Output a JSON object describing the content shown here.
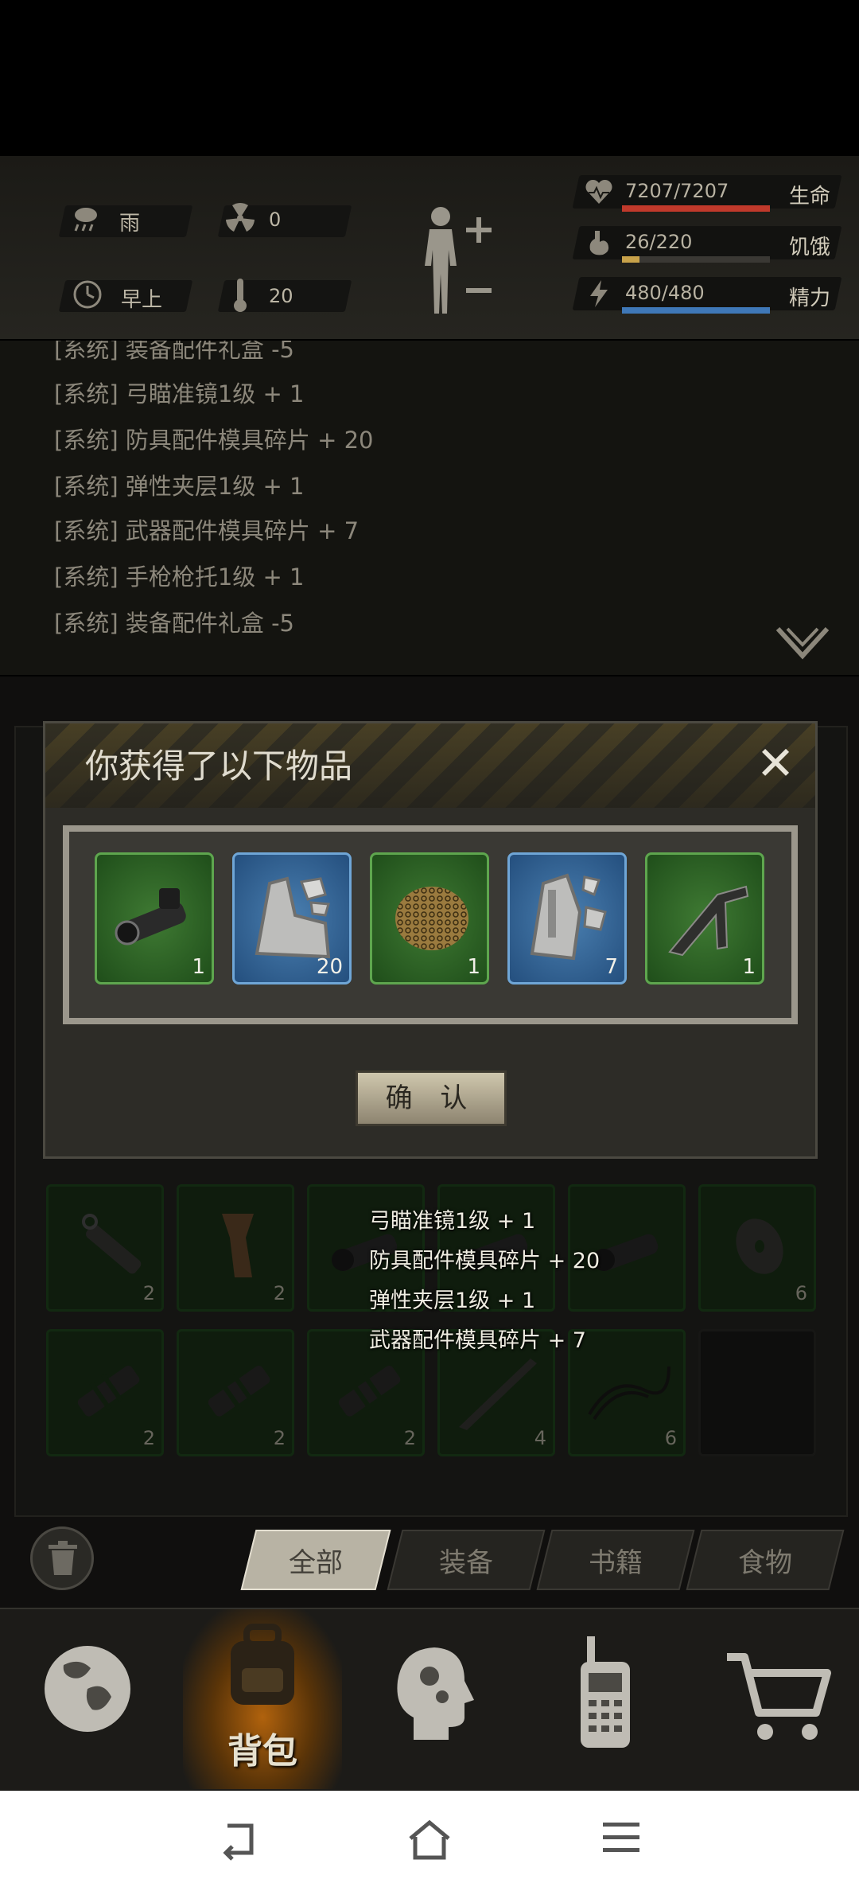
{
  "status": {
    "weather": "雨",
    "radiation": "0",
    "time_of_day": "早上",
    "temperature": "20",
    "health": {
      "text": "7207/7207",
      "label": "生命",
      "fraction": 1.0,
      "color": "#c0392b"
    },
    "hunger": {
      "text": "26/220",
      "label": "饥饿",
      "fraction": 0.118,
      "color": "#c8a24a"
    },
    "energy": {
      "text": "480/480",
      "label": "精力",
      "fraction": 1.0,
      "color": "#3f78b8"
    }
  },
  "log": [
    "[系统] 装备配件礼盒 -5",
    "[系统] 弓瞄准镜1级 + 1",
    "[系统] 防具配件模具碎片 + 20",
    "[系统] 弹性夹层1级 + 1",
    "[系统] 武器配件模具碎片 + 7",
    "[系统] 手枪枪托1级 + 1",
    "[系统] 装备配件礼盒 -5"
  ],
  "popup": {
    "title": "你获得了以下物品",
    "confirm_label": "确 认",
    "items": [
      {
        "icon": "scope-icon",
        "count": "1",
        "rarity": "green"
      },
      {
        "icon": "armor-mold-fragment-icon",
        "count": "20",
        "rarity": "blue"
      },
      {
        "icon": "elastic-mesh-icon",
        "count": "1",
        "rarity": "green"
      },
      {
        "icon": "weapon-mold-fragment-icon",
        "count": "7",
        "rarity": "blue"
      },
      {
        "icon": "pistol-stock-icon",
        "count": "1",
        "rarity": "green"
      }
    ]
  },
  "notices": [
    "弓瞄准镜1级 + 1",
    "防具配件模具碎片 + 20",
    "弹性夹层1级 + 1",
    "武器配件模具碎片 + 7"
  ],
  "inventory": {
    "row1": [
      {
        "icon": "pipe-icon",
        "count": "2"
      },
      {
        "icon": "grip-icon",
        "count": "2"
      },
      {
        "icon": "scope-icon",
        "count": ""
      },
      {
        "icon": "scope-icon",
        "count": ""
      },
      {
        "icon": "scope-icon",
        "count": ""
      },
      {
        "icon": "washer-icon",
        "count": "6"
      }
    ],
    "row2": [
      {
        "icon": "muzzle-brake-icon",
        "count": "2"
      },
      {
        "icon": "muzzle-brake-icon",
        "count": "2"
      },
      {
        "icon": "muzzle-brake-icon",
        "count": "2"
      },
      {
        "icon": "blade-icon",
        "count": "4"
      },
      {
        "icon": "rope-icon",
        "count": "6"
      },
      {
        "icon": "",
        "count": ""
      }
    ]
  },
  "filter_tabs": [
    "全部",
    "装备",
    "书籍",
    "食物"
  ],
  "nav": {
    "bag_label": "背包",
    "items": [
      "globe-icon",
      "backpack-icon",
      "head-gears-icon",
      "radio-icon",
      "cart-icon"
    ]
  },
  "colors": {
    "accent_orange": "#b0620d",
    "rare_blue": "#244f7e",
    "common_green": "#1f4e1a"
  }
}
